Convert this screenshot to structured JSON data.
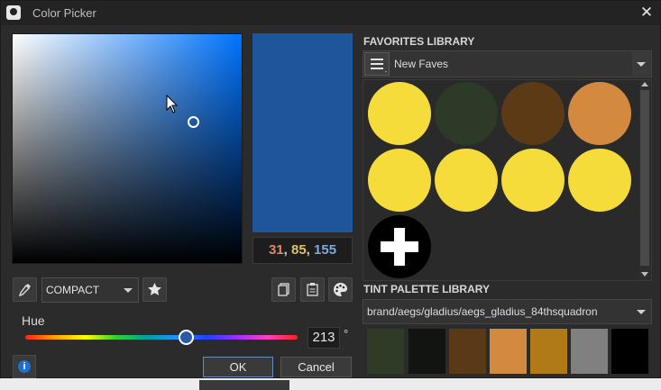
{
  "window": {
    "title": "Color Picker",
    "close_glyph": "✕"
  },
  "current_color": {
    "hex": "#1f559b",
    "r": "31",
    "g": "85",
    "b": "155",
    "separator": ", "
  },
  "toolbar": {
    "mode": "COMPACT"
  },
  "hue": {
    "label": "Hue",
    "value": "213",
    "unit": "°",
    "fraction": 0.59
  },
  "buttons": {
    "ok": "OK",
    "cancel": "Cancel",
    "info": "i"
  },
  "favorites": {
    "section_title": "FAVORITES LIBRARY",
    "library_name": "New Faves",
    "colors": [
      "#f5dc3a",
      "#2d3a28",
      "#5c3a15",
      "#d48a3e",
      "#f5dc3a",
      "#f5dc3a",
      "#f5dc3a",
      "#f5dc3a"
    ],
    "add_icon": "plus-icon"
  },
  "tint_palette": {
    "section_title": "TINT PALETTE LIBRARY",
    "path": "brand/aegs/gladius/aegs_gladius_84thsquadron",
    "colors": [
      "#2f3a27",
      "#121412",
      "#5a3a16",
      "#d48a3e",
      "#b07a18",
      "#808080",
      "#000000"
    ]
  }
}
